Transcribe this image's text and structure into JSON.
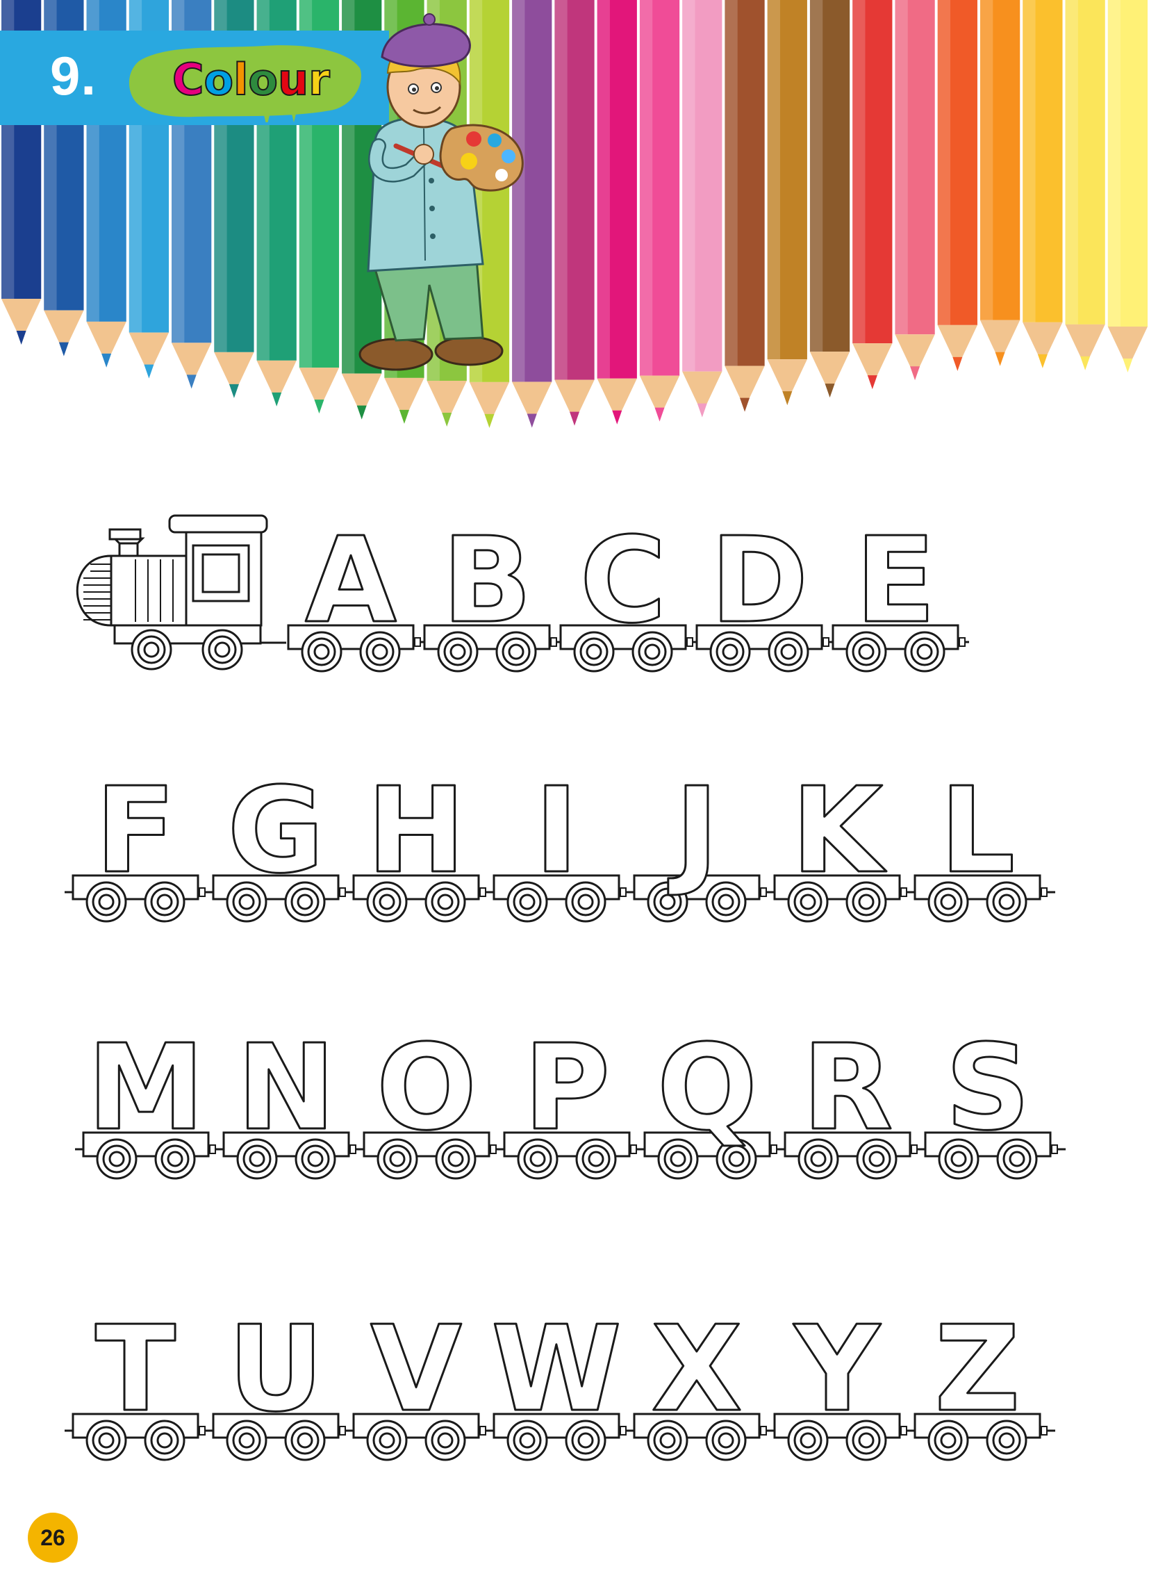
{
  "header": {
    "number": "9.",
    "title": "Colour",
    "title_letter_colors": [
      "#e6007e",
      "#00a0e3",
      "#f39200",
      "#2e8b3e",
      "#e30613",
      "#f7d117"
    ]
  },
  "pencil_colors": [
    "#1b3f8f",
    "#1f5aa6",
    "#2a86c9",
    "#2fa4dc",
    "#3a7fc1",
    "#1c8c82",
    "#1fa076",
    "#2ab46a",
    "#1e8f43",
    "#5bb532",
    "#8cc63f",
    "#b5d234",
    "#8e4d9c",
    "#c0367c",
    "#e2167a",
    "#f04c97",
    "#f29cc2",
    "#a0522d",
    "#c08226",
    "#8b5a2b",
    "#e53935",
    "#f06b85",
    "#f05a28",
    "#f7901e",
    "#fbc02d",
    "#fbe55a",
    "#fff176"
  ],
  "train": {
    "rows": [
      [
        "A",
        "B",
        "C",
        "D",
        "E"
      ],
      [
        "F",
        "G",
        "H",
        "I",
        "J",
        "K",
        "L"
      ],
      [
        "M",
        "N",
        "O",
        "P",
        "Q",
        "R",
        "S"
      ],
      [
        "T",
        "U",
        "V",
        "W",
        "X",
        "Y",
        "Z"
      ]
    ]
  },
  "footer": {
    "page_number": "26"
  },
  "colors": {
    "banner": "#29a8e0",
    "splash": "#8dc63f",
    "page_badge": "#f4b400",
    "outline": "#1a1a1a"
  }
}
